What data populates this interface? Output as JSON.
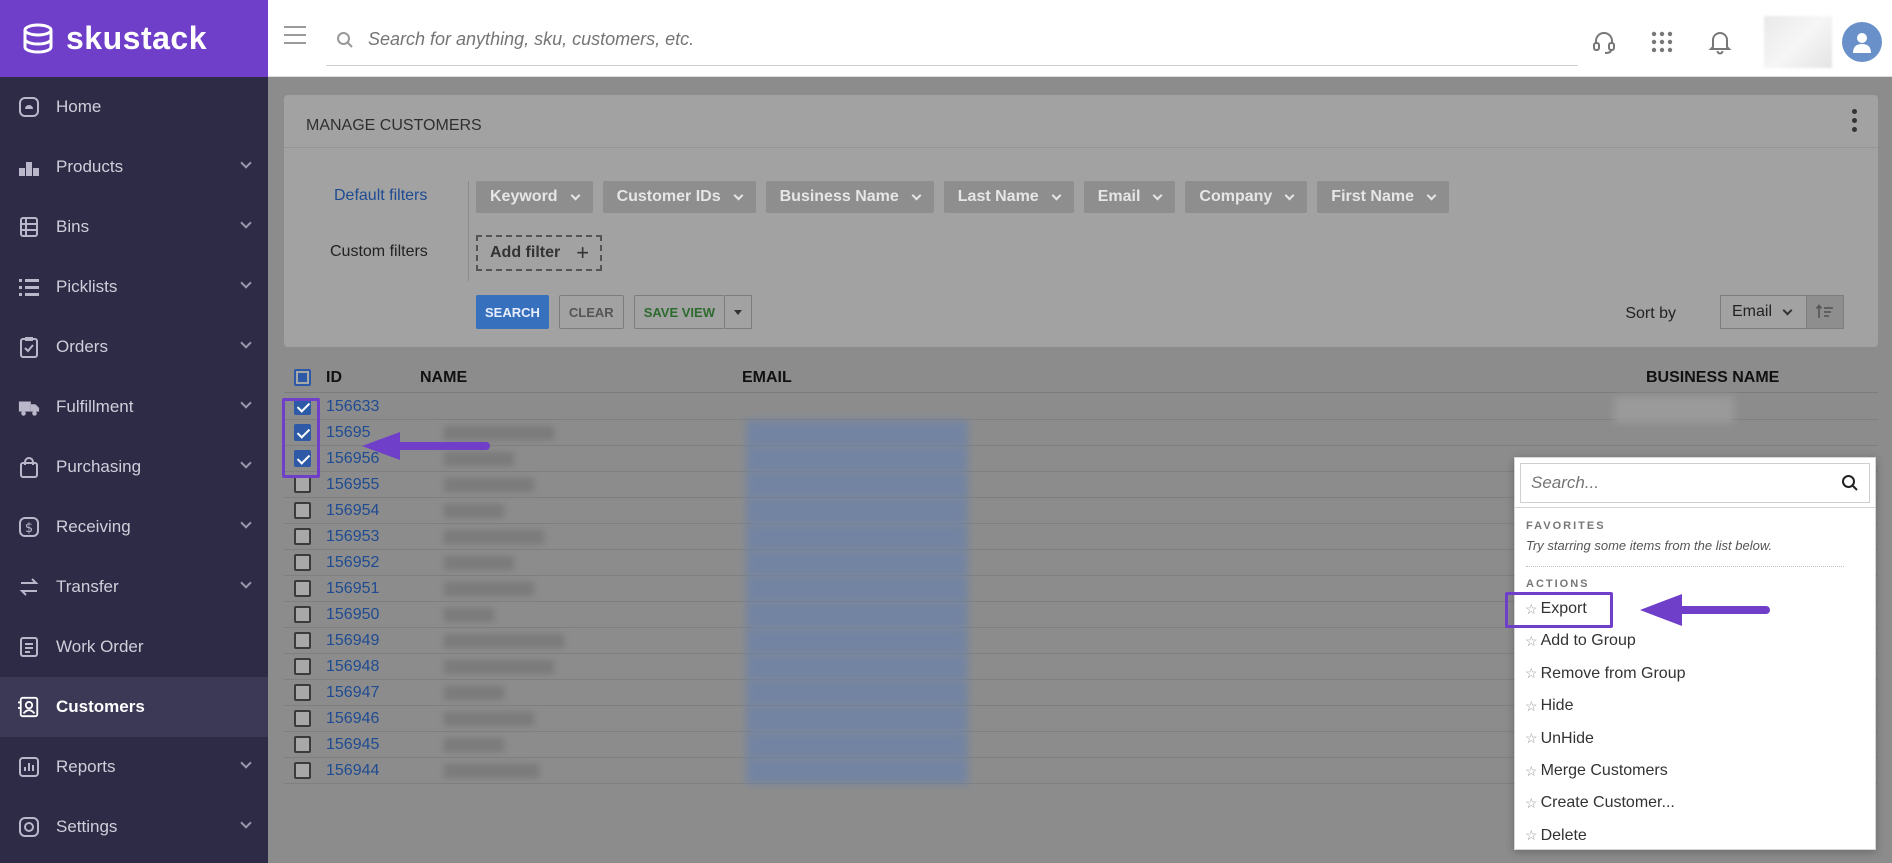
{
  "brand": {
    "name": "skustack"
  },
  "topbar": {
    "search_placeholder": "Search for anything, sku, customers, etc."
  },
  "sidebar": {
    "items": [
      {
        "label": "Home",
        "icon": "home-icon",
        "expandable": false
      },
      {
        "label": "Products",
        "icon": "products-icon",
        "expandable": true
      },
      {
        "label": "Bins",
        "icon": "bins-icon",
        "expandable": true
      },
      {
        "label": "Picklists",
        "icon": "picklists-icon",
        "expandable": true
      },
      {
        "label": "Orders",
        "icon": "orders-icon",
        "expandable": true
      },
      {
        "label": "Fulfillment",
        "icon": "truck-icon",
        "expandable": true
      },
      {
        "label": "Purchasing",
        "icon": "bag-icon",
        "expandable": true
      },
      {
        "label": "Receiving",
        "icon": "dollar-icon",
        "expandable": true
      },
      {
        "label": "Transfer",
        "icon": "transfer-icon",
        "expandable": true
      },
      {
        "label": "Work Order",
        "icon": "work-order-icon",
        "expandable": false
      },
      {
        "label": "Customers",
        "icon": "customers-icon",
        "expandable": false,
        "active": true
      },
      {
        "label": "Reports",
        "icon": "reports-icon",
        "expandable": true
      },
      {
        "label": "Settings",
        "icon": "settings-icon",
        "expandable": true
      }
    ]
  },
  "panel": {
    "title": "MANAGE CUSTOMERS",
    "default_filters_label": "Default filters",
    "custom_filters_label": "Custom filters",
    "filters": [
      "Keyword",
      "Customer IDs",
      "Business Name",
      "Last Name",
      "Email",
      "Company",
      "First Name"
    ],
    "add_filter": "Add filter",
    "buttons": {
      "search": "SEARCH",
      "clear": "CLEAR",
      "save_view": "SAVE VIEW"
    },
    "sort_by_label": "Sort by",
    "sort_value": "Email"
  },
  "table": {
    "headers": {
      "id": "ID",
      "name": "NAME",
      "email": "EMAIL",
      "business_name": "BUSINESS NAME"
    },
    "rows": [
      {
        "id": "156633",
        "checked": true
      },
      {
        "id": "15695",
        "checked": true
      },
      {
        "id": "156956",
        "checked": true
      },
      {
        "id": "156955",
        "checked": false
      },
      {
        "id": "156954",
        "checked": false
      },
      {
        "id": "156953",
        "checked": false
      },
      {
        "id": "156952",
        "checked": false
      },
      {
        "id": "156951",
        "checked": false
      },
      {
        "id": "156950",
        "checked": false
      },
      {
        "id": "156949",
        "checked": false
      },
      {
        "id": "156948",
        "checked": false
      },
      {
        "id": "156947",
        "checked": false
      },
      {
        "id": "156946",
        "checked": false
      },
      {
        "id": "156945",
        "checked": false
      },
      {
        "id": "156944",
        "checked": false
      }
    ]
  },
  "dropdown": {
    "search_placeholder": "Search...",
    "favorites_label": "FAVORITES",
    "favorites_hint": "Try starring some items from the list below.",
    "actions_label": "ACTIONS",
    "actions": [
      "Export",
      "Add to Group",
      "Remove from Group",
      "Hide",
      "UnHide",
      "Merge Customers",
      "Create Customer...",
      "Delete"
    ]
  },
  "colors": {
    "brand": "#6f3fc9",
    "sidebar": "#2e2b47",
    "link": "#1f4b92",
    "annotation": "#6f3fc9"
  }
}
